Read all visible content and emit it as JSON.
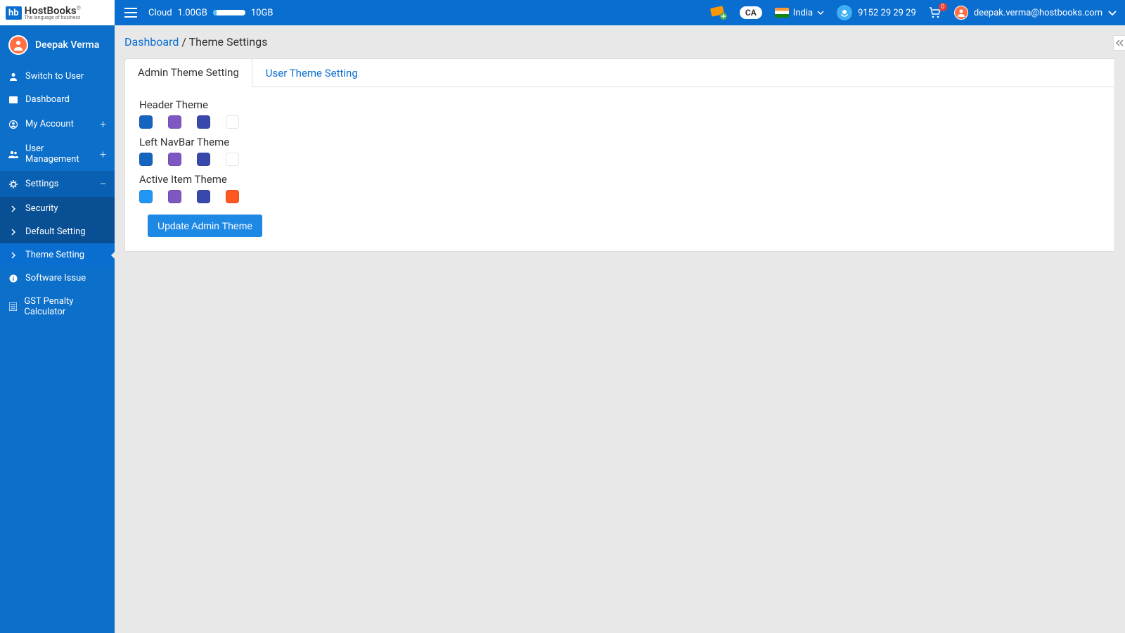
{
  "header": {
    "logo_main": "HostBooks",
    "logo_sub": "The language of business",
    "cloud_label": "Cloud",
    "cloud_used": "1.00GB",
    "cloud_total": "10GB",
    "country": "India",
    "phone": "9152 29 29 29",
    "cart_count": "0",
    "user_email": "deepak.verma@hostbooks.com"
  },
  "sidebar": {
    "user_name": "Deepak Verma",
    "items": {
      "switch_user": "Switch to User",
      "dashboard": "Dashboard",
      "my_account": "My Account",
      "user_mgmt": "User Management",
      "settings": "Settings",
      "software_issue": "Software Issue",
      "gst_calc": "GST Penalty Calculator"
    },
    "settings_sub": {
      "security": "Security",
      "default_setting": "Default Setting",
      "theme_setting": "Theme Setting"
    }
  },
  "breadcrumb": {
    "dashboard": "Dashboard",
    "sep": " / ",
    "current": "Theme Settings"
  },
  "tabs": {
    "admin": "Admin Theme Setting",
    "user": "User Theme Setting"
  },
  "theme": {
    "header_label": "Header Theme",
    "navbar_label": "Left NavBar Theme",
    "active_label": "Active Item Theme",
    "update_btn": "Update Admin Theme",
    "header_colors": [
      "#1565c0",
      "#7e57c2",
      "#3949ab",
      "#ffffff"
    ],
    "navbar_colors": [
      "#1565c0",
      "#7e57c2",
      "#3949ab",
      "#ffffff"
    ],
    "active_colors": [
      "#2196f3",
      "#7e57c2",
      "#3949ab",
      "#ff5722"
    ]
  }
}
